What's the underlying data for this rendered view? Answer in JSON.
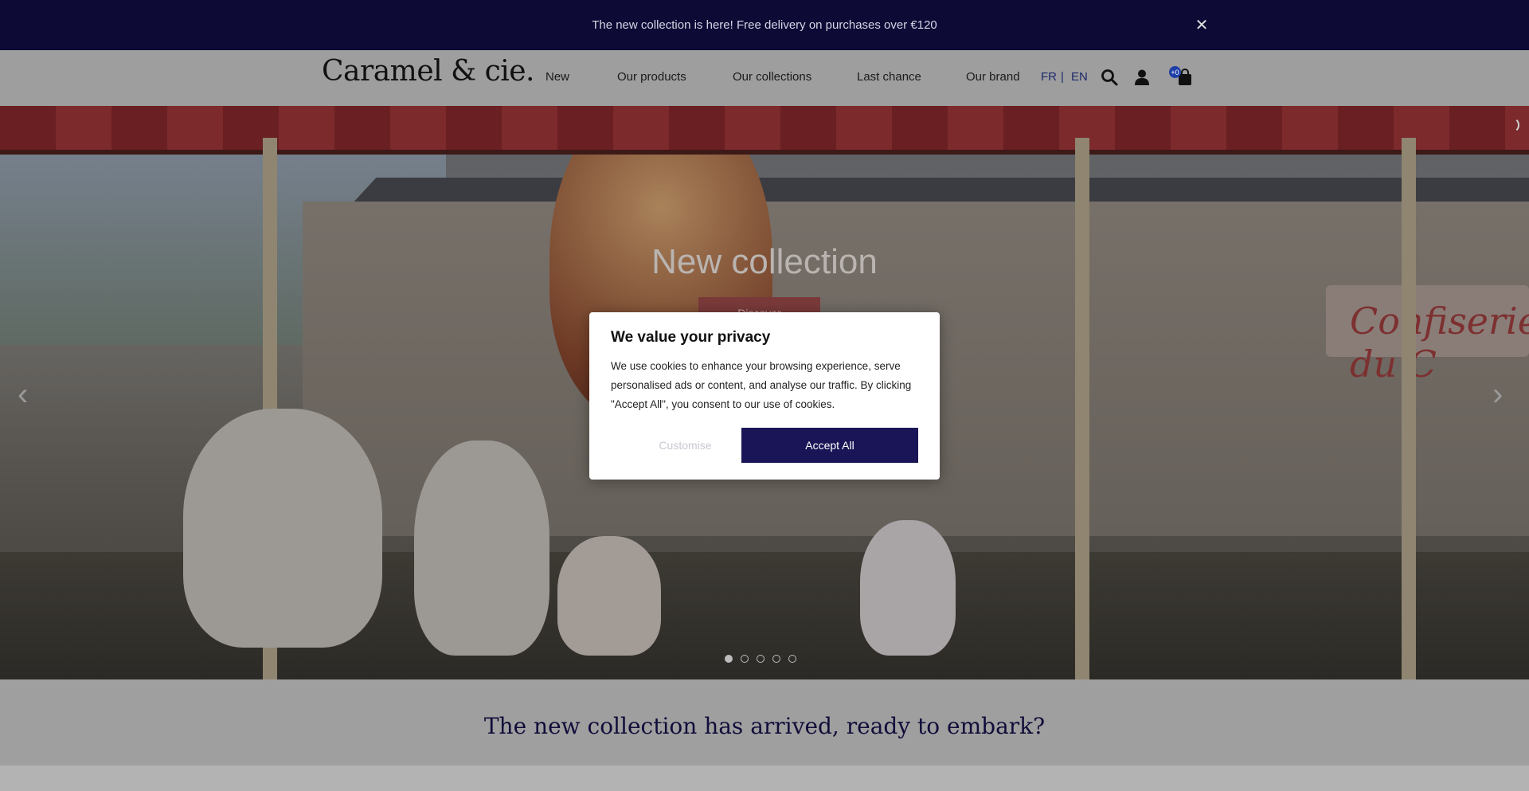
{
  "announcement": {
    "text": "The new collection is here! Free delivery on purchases over €120",
    "close_icon": "close-icon"
  },
  "header": {
    "logo": "Caramel & cie.",
    "nav": [
      {
        "label": "New"
      },
      {
        "label": "Our products"
      },
      {
        "label": "Our collections"
      },
      {
        "label": "Last chance"
      },
      {
        "label": "Our brand"
      }
    ],
    "languages": {
      "fr": "FR",
      "separator": "|",
      "en": "EN"
    },
    "icons": [
      "search-icon",
      "account-icon",
      "cart-icon"
    ],
    "cart_count": "+0"
  },
  "hero": {
    "title": "New collection",
    "button_label": "Discover",
    "prev_arrow": "‹",
    "next_arrow": "›",
    "slides": 5,
    "active_slide": 1
  },
  "tagline": "The new collection has arrived, ready to embark?",
  "cookie_modal": {
    "title": "We value your privacy",
    "body": "We use cookies to enhance your browsing experience, serve personalised ads or content, and analyse our traffic. By clicking \"Accept All\", you consent to our use of cookies.",
    "customise_label": "Customise",
    "accept_label": "Accept All"
  },
  "colors": {
    "announcement_bg": "#0d0a35",
    "accent": "#1a1556"
  }
}
